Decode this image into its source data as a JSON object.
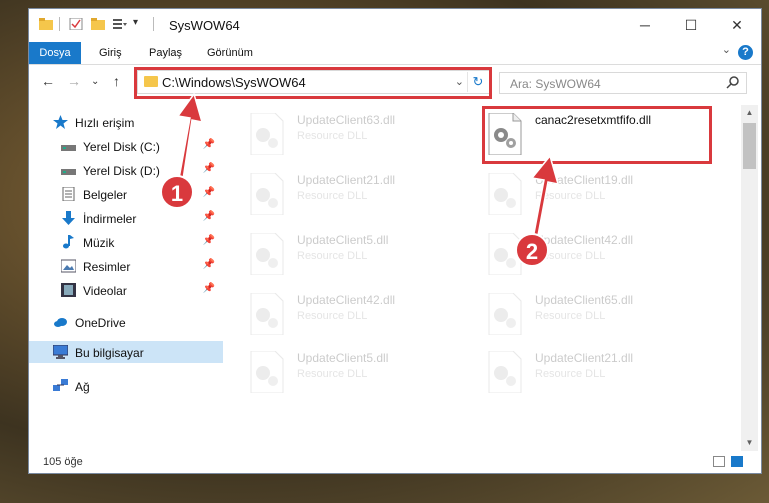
{
  "window": {
    "title": "SysWOW64",
    "controls": {
      "minimize": "─",
      "maximize": "☐",
      "close": "✕"
    }
  },
  "ribbon": {
    "tabs": [
      "Dosya",
      "Giriş",
      "Paylaş",
      "Görünüm"
    ],
    "help": "?",
    "expand": "⌄"
  },
  "navigation": {
    "back": "←",
    "forward": "→",
    "recent": "⌄",
    "up": "↑",
    "address": "C:\\Windows\\SysWOW64",
    "address_dropdown": "⌄",
    "refresh": "↻"
  },
  "search": {
    "placeholder": "Ara: SysWOW64",
    "icon": "search-icon"
  },
  "sidebar": {
    "quick_access": "Hızlı erişim",
    "items": [
      {
        "label": "Yerel Disk (C:)",
        "icon": "drive-icon",
        "pinned": true
      },
      {
        "label": "Yerel Disk (D:)",
        "icon": "drive-icon",
        "pinned": true
      },
      {
        "label": "Belgeler",
        "icon": "documents-icon",
        "pinned": true
      },
      {
        "label": "İndirmeler",
        "icon": "downloads-icon",
        "pinned": true
      },
      {
        "label": "Müzik",
        "icon": "music-icon",
        "pinned": true
      },
      {
        "label": "Resimler",
        "icon": "pictures-icon",
        "pinned": true
      },
      {
        "label": "Videolar",
        "icon": "videos-icon",
        "pinned": true
      }
    ],
    "onedrive": "OneDrive",
    "this_pc": "Bu bilgisayar",
    "network": "Ağ",
    "pin_glyph": "📌"
  },
  "files": [
    {
      "name": "UpdateClient63.dll",
      "type": "Resource DLL",
      "highlighted": false
    },
    {
      "name": "canac2resetxmtfifo.dll",
      "type": "",
      "highlighted": true
    },
    {
      "name": "UpdateClient21.dll",
      "type": "Resource DLL",
      "highlighted": false
    },
    {
      "name": "UpdateClient19.dll",
      "type": "Resource DLL",
      "highlighted": false
    },
    {
      "name": "UpdateClient5.dll",
      "type": "Resource DLL",
      "highlighted": false
    },
    {
      "name": "UpdateClient42.dll",
      "type": "Resource DLL",
      "highlighted": false
    },
    {
      "name": "UpdateClient42.dll",
      "type": "Resource DLL",
      "highlighted": false
    },
    {
      "name": "UpdateClient65.dll",
      "type": "Resource DLL",
      "highlighted": false
    },
    {
      "name": "UpdateClient5.dll",
      "type": "Resource DLL",
      "highlighted": false
    },
    {
      "name": "UpdateClient21.dll",
      "type": "Resource DLL",
      "highlighted": false
    }
  ],
  "status": {
    "item_count": "105 öğe"
  },
  "annotations": {
    "step1": "1",
    "step2": "2",
    "color": "#d9393d"
  },
  "colors": {
    "accent": "#1979ca",
    "highlight_red": "#d9393d",
    "selected_nav": "#cce4f7"
  }
}
